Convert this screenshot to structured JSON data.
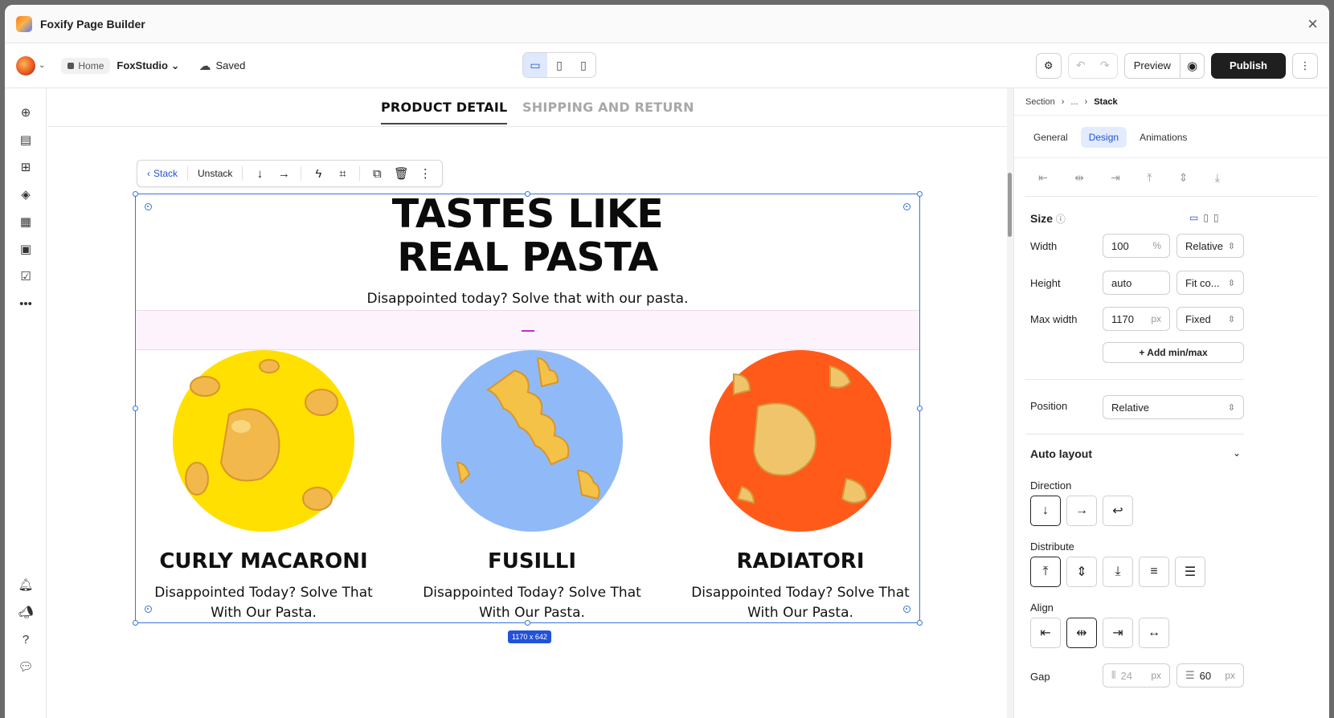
{
  "app": {
    "title": "Foxify Page Builder"
  },
  "toolbar": {
    "home_label": "Home",
    "store_name": "FoxStudio",
    "saved_label": "Saved",
    "preview_label": "Preview",
    "publish_label": "Publish"
  },
  "canvas_tabs": [
    {
      "label": "PRODUCT DETAIL",
      "active": true
    },
    {
      "label": "SHIPPING AND RETURN",
      "active": false
    }
  ],
  "stack_toolbar": {
    "back_label": "Stack",
    "unstack_label": "Unstack"
  },
  "section": {
    "headline_line1": "TASTES LIKE",
    "headline_line2": "REAL PASTA",
    "subheadline": "Disappointed today? Solve that with our pasta.",
    "size_badge": "1170 x 642"
  },
  "products": [
    {
      "name": "CURLY MACARONI",
      "desc_line1": "Disappointed Today? Solve That",
      "desc_line2": "With Our Pasta.",
      "bg": "#ffe000"
    },
    {
      "name": "FUSILLI",
      "desc_line1": "Disappointed Today? Solve That",
      "desc_line2": "With Our Pasta.",
      "bg": "#8fbaf7"
    },
    {
      "name": "RADIATORI",
      "desc_line1": "Disappointed Today? Solve That",
      "desc_line2": "With Our Pasta.",
      "bg": "#ff5a1a"
    }
  ],
  "right_panel": {
    "breadcrumb": {
      "root": "Section",
      "ellipsis": "...",
      "current": "Stack"
    },
    "tabs": [
      {
        "label": "General",
        "active": false
      },
      {
        "label": "Design",
        "active": true
      },
      {
        "label": "Animations",
        "active": false
      }
    ],
    "size_title": "Size",
    "width": {
      "label": "Width",
      "value": "100",
      "unit": "%",
      "mode": "Relative"
    },
    "height": {
      "label": "Height",
      "value": "auto",
      "mode": "Fit co..."
    },
    "max_width": {
      "label": "Max width",
      "value": "1170",
      "unit": "px",
      "mode": "Fixed"
    },
    "add_minmax_label": "+ Add min/max",
    "position": {
      "label": "Position",
      "value": "Relative"
    },
    "auto_layout_title": "Auto layout",
    "direction_label": "Direction",
    "distribute_label": "Distribute",
    "align_label": "Align",
    "gap": {
      "label": "Gap",
      "col_value": "24",
      "col_unit": "px",
      "row_value": "60",
      "row_unit": "px"
    }
  },
  "colors": {
    "accent": "#2152d9",
    "selection": "#3a74d9",
    "publish_bg": "#1f1f1f"
  }
}
